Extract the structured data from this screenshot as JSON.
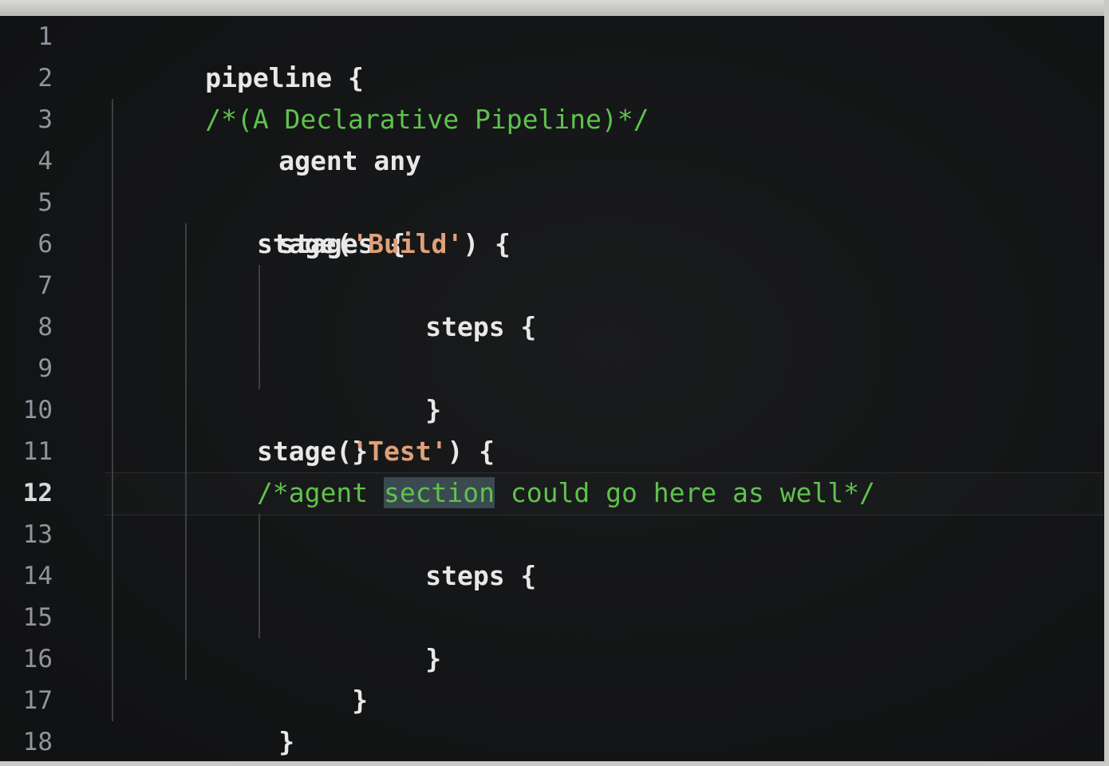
{
  "editor": {
    "line_numbers": [
      "1",
      "2",
      "3",
      "4",
      "5",
      "6",
      "7",
      "8",
      "9",
      "10",
      "11",
      "12",
      "13",
      "14",
      "15",
      "16",
      "17",
      "18"
    ],
    "current_line": "12",
    "lines": {
      "l1": "pipeline {",
      "l2": "/*(A Declarative Pipeline)*/",
      "l3": "agent any",
      "l5": "stages {",
      "l6_pre": "stage(",
      "l6_str": "'Build'",
      "l6_post": ") {",
      "l7": "steps {",
      "l9": "}",
      "l10": "}",
      "l11_pre": "stage(",
      "l11_str": "'Test'",
      "l11_post": ") {",
      "l12_a": "/*agent ",
      "l12_sel": "section",
      "l12_b": " could go here as well*/",
      "l13": "steps {",
      "l15": "}",
      "l16": "}",
      "l17": "}",
      "l18": "}"
    }
  },
  "colors": {
    "background": "#141516",
    "comment": "#5fc24d",
    "string": "#e0a078",
    "text": "#e6e6e6",
    "line_number": "#8f959d",
    "selection": "#3a4a50"
  }
}
